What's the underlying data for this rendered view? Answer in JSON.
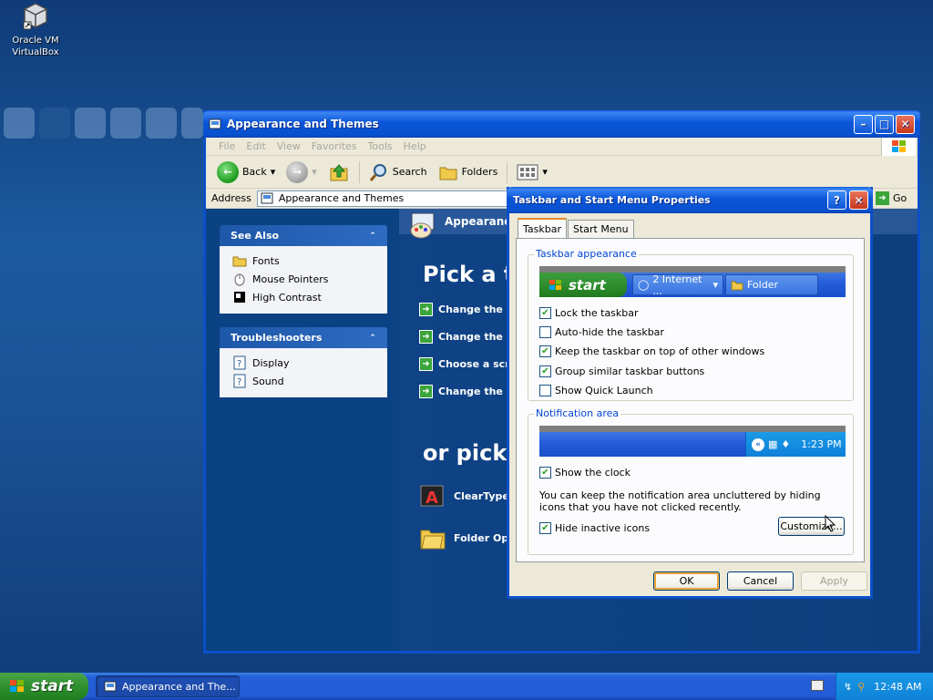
{
  "desktop": {
    "icon_label_1": "Oracle VM",
    "icon_label_2": "VirtualBox"
  },
  "explorer": {
    "title": "Appearance and Themes",
    "menu": [
      "File",
      "Edit",
      "View",
      "Favorites",
      "Tools",
      "Help"
    ],
    "toolbar": {
      "back": "Back",
      "search": "Search",
      "folders": "Folders"
    },
    "address": {
      "label": "Address",
      "value": "Appearance and Themes",
      "go": "Go"
    },
    "see_also": {
      "title": "See Also",
      "items": [
        "Fonts",
        "Mouse Pointers",
        "High Contrast"
      ]
    },
    "troubleshooters": {
      "title": "Troubleshooters",
      "items": [
        "Display",
        "Sound"
      ]
    },
    "category_title": "Appearance",
    "pick_task": "Pick a t",
    "tasks": [
      "Change the co",
      "Change the de",
      "Choose a scre",
      "Change the sc"
    ],
    "pick_icon": "or pick",
    "icons": [
      "ClearType T",
      "Folder Opti"
    ]
  },
  "dialog": {
    "title": "Taskbar and Start Menu Properties",
    "tabs": [
      "Taskbar",
      "Start Menu"
    ],
    "taskbar_group_label": "Taskbar appearance",
    "preview": {
      "start": "start",
      "btn1": "2 Internet ...",
      "btn2": "Folder"
    },
    "options": [
      {
        "label": "Lock the taskbar",
        "checked": true
      },
      {
        "label": "Auto-hide the taskbar",
        "checked": false
      },
      {
        "label": "Keep the taskbar on top of other windows",
        "checked": true
      },
      {
        "label": "Group similar taskbar buttons",
        "checked": true
      },
      {
        "label": "Show Quick Launch",
        "checked": false
      }
    ],
    "notif_group_label": "Notification area",
    "notif_preview_time": "1:23 PM",
    "show_clock": {
      "label": "Show the clock",
      "checked": true
    },
    "notif_text": "You can keep the notification area uncluttered by hiding icons that you have not clicked recently.",
    "hide_inactive": {
      "label": "Hide inactive icons",
      "checked": true
    },
    "customize": "Customize...",
    "ok": "OK",
    "cancel": "Cancel",
    "apply": "Apply"
  },
  "taskbar": {
    "start": "start",
    "task_button": "Appearance and The...",
    "clock": "12:48 AM"
  },
  "colors": {
    "xp_blue": "#0b4fc9",
    "start_green": "#2f902f",
    "tray_blue": "#0f82d8"
  }
}
